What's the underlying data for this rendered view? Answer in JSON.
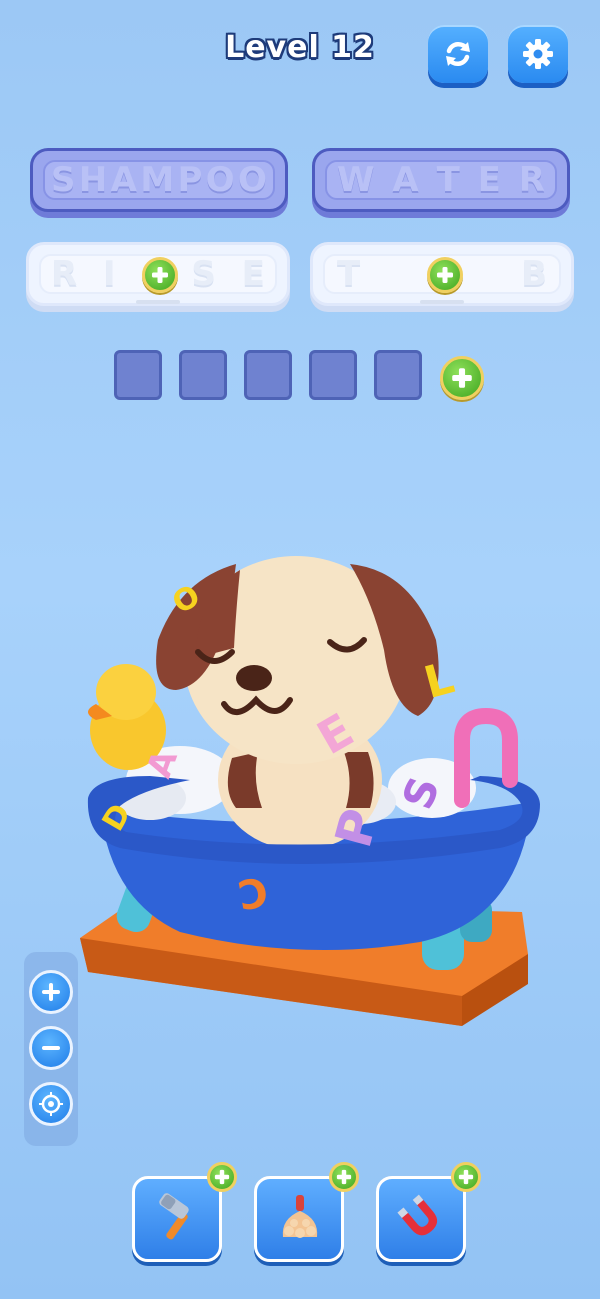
{
  "header": {
    "level_label": "Level 12",
    "restart_icon": "refresh-icon",
    "settings_icon": "gear-icon"
  },
  "word_slots": [
    {
      "state": "solved",
      "letters": [
        "S",
        "H",
        "A",
        "M",
        "P",
        "O",
        "O"
      ]
    },
    {
      "state": "solved",
      "letters": [
        "W",
        "A",
        "T",
        "E",
        "R"
      ]
    },
    {
      "state": "hint",
      "letters": [
        "R",
        "I",
        "",
        "S",
        "E"
      ]
    },
    {
      "state": "hint",
      "letters": [
        "T",
        "",
        "",
        "",
        "B"
      ]
    }
  ],
  "answer_row": {
    "box_count": 5
  },
  "floating_letters": [
    "L",
    "E",
    "A",
    "P",
    "S",
    "D",
    "C",
    "O"
  ],
  "side_controls": {
    "zoom_in_icon": "plus-icon",
    "zoom_out_icon": "minus-icon",
    "recenter_icon": "target-icon"
  },
  "tools": [
    {
      "name": "hammer",
      "icon": "hammer-icon"
    },
    {
      "name": "brush",
      "icon": "brush-icon"
    },
    {
      "name": "magnet",
      "icon": "magnet-icon"
    }
  ],
  "colors": {
    "button_blue": "#2a8af0",
    "solved_slot": "#9aa6ee",
    "plus_green": "#3fa51f",
    "tub_blue": "#2f63d8",
    "platform_orange": "#f07d2a"
  }
}
